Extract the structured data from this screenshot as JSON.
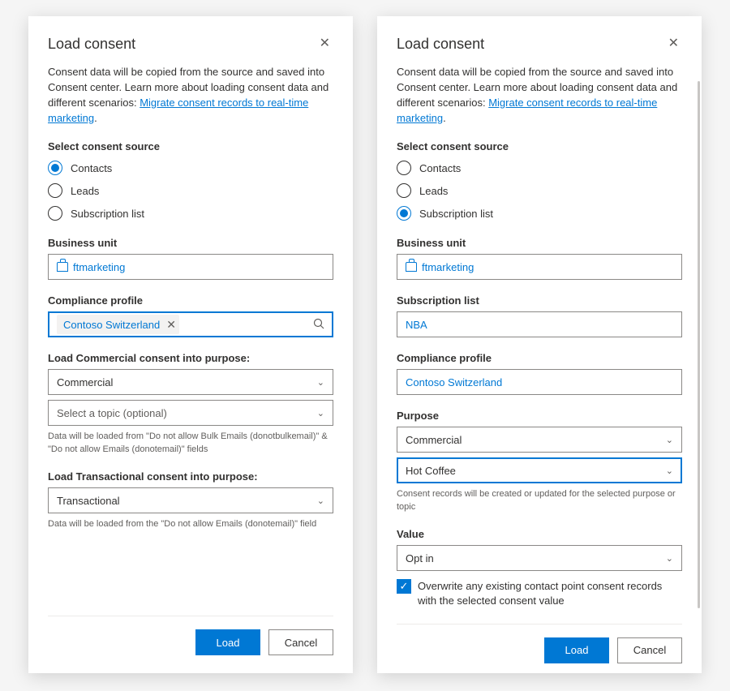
{
  "common": {
    "title": "Load consent",
    "description_prefix": "Consent data will be copied from the source and saved into Consent center. Learn more about loading consent data and different scenarios: ",
    "link_text": "Migrate consent records to real-time marketing",
    "link_suffix": ".",
    "source_heading": "Select consent source",
    "radio_contacts": "Contacts",
    "radio_leads": "Leads",
    "radio_subscription": "Subscription list",
    "business_unit_label": "Business unit",
    "business_unit_value": "ftmarketing",
    "compliance_profile_label": "Compliance profile",
    "compliance_profile_value": "Contoso Switzerland",
    "load_btn": "Load",
    "cancel_btn": "Cancel"
  },
  "panel1": {
    "commercial_heading": "Load Commercial consent into purpose:",
    "commercial_value": "Commercial",
    "topic_placeholder": "Select a topic (optional)",
    "commercial_helper": "Data will be loaded from \"Do not allow Bulk Emails (donotbulkemail)\" & \"Do not allow Emails (donotemail)\" fields",
    "transactional_heading": "Load Transactional consent into purpose:",
    "transactional_value": "Transactional",
    "transactional_helper": "Data will be loaded from the \"Do not allow Emails (donotemail)\" field"
  },
  "panel2": {
    "subscription_list_label": "Subscription list",
    "subscription_list_value": "NBA",
    "purpose_label": "Purpose",
    "purpose_value": "Commercial",
    "topic_value": "Hot Coffee",
    "purpose_helper": "Consent records will be created or updated for the selected purpose or topic",
    "value_label": "Value",
    "value_value": "Opt in",
    "checkbox_label": "Overwrite any existing contact point consent records with the selected consent value"
  }
}
